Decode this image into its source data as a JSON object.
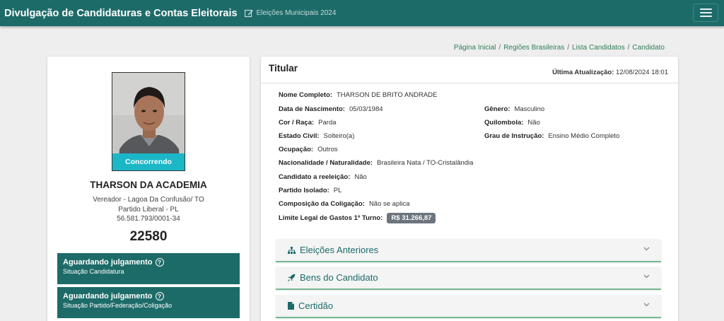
{
  "header": {
    "title": "Divulgação de Candidaturas e Contas Eleitorais",
    "subtitle": "Eleições Municipais 2024"
  },
  "breadcrumb": [
    "Página Inicial",
    "Regiões Brasileiras",
    "Lista Candidatos",
    "Candidato"
  ],
  "candidate": {
    "status_badge": "Concorrendo",
    "name": "THARSON DA ACADEMIA",
    "office_location": "Vereador - Lagoa Da Confusão/ TO",
    "party": "Partido Liberal - PL",
    "cnpj": "56.581.793/0001-34",
    "number": "22580"
  },
  "status_cards": [
    {
      "title": "Aguardando julgamento",
      "subtitle": "Situação Candidatura"
    },
    {
      "title": "Aguardando julgamento",
      "subtitle": "Situação Partido/Federação/Coligação"
    }
  ],
  "details": {
    "title": "Titular",
    "last_update_label": "Última Atualização:",
    "last_update_value": "12/08/2024 18:01",
    "fields": {
      "full_name": {
        "label": "Nome Completo:",
        "value": "THARSON DE BRITO ANDRADE"
      },
      "birth_date": {
        "label": "Data de Nascimento:",
        "value": "05/03/1984"
      },
      "gender": {
        "label": "Gênero:",
        "value": "Masculino"
      },
      "race": {
        "label": "Cor / Raça:",
        "value": "Parda"
      },
      "quilombola": {
        "label": "Quilombola:",
        "value": "Não"
      },
      "marital": {
        "label": "Estado Civil:",
        "value": "Solteiro(a)"
      },
      "education": {
        "label": "Grau de Instrução:",
        "value": "Ensino Médio Completo"
      },
      "occupation": {
        "label": "Ocupação:",
        "value": "Outros"
      },
      "nationality": {
        "label": "Nacionalidade / Naturalidade:",
        "value": "Brasileira Nata / TO-Cristalândia"
      },
      "reelection": {
        "label": "Candidato a reeleição:",
        "value": "Não"
      },
      "party_isolated": {
        "label": "Partido Isolado:",
        "value": "PL"
      },
      "coalition": {
        "label": "Composição da Coligação:",
        "value": "Não se aplica"
      },
      "spending_limit": {
        "label": "Limite Legal de Gastos 1º Turno:",
        "value": "R$ 31.266,87"
      }
    }
  },
  "accordions": [
    {
      "label": "Eleições Anteriores",
      "icon": "sitemap-icon"
    },
    {
      "label": "Bens do Candidato",
      "icon": "rocket-icon"
    },
    {
      "label": "Certidão",
      "icon": "file-icon"
    }
  ],
  "colors": {
    "primary": "#1d6b69",
    "badge": "#1bb7c7",
    "accent_green": "#76b890"
  }
}
